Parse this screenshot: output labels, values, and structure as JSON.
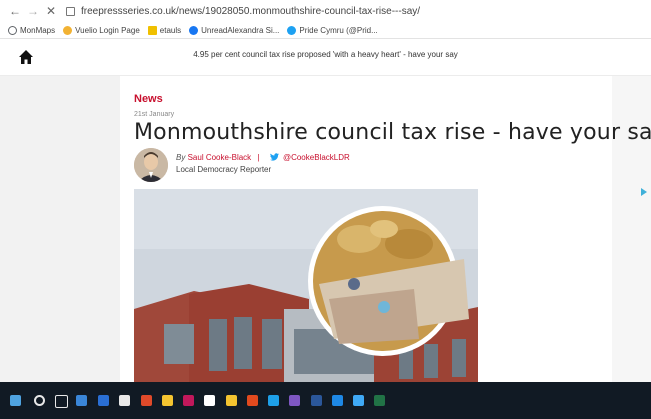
{
  "browser": {
    "url": "freepressseries.co.uk/news/19028050.monmouthshire-council-tax-rise---say/",
    "bookmarks": [
      {
        "label": "MonMaps",
        "color": "#5f6368"
      },
      {
        "label": "Vuelio Login Page",
        "color": "#f2b233"
      },
      {
        "label": "etauls",
        "color": "#f0c000"
      },
      {
        "label": "UnreadAlexandra Si...",
        "color": "#1877f2"
      },
      {
        "label": "Pride Cymru (@Prid...",
        "color": "#1da1f2"
      }
    ]
  },
  "site": {
    "header_title": "4.95 per cent council tax rise proposed 'with a heavy heart' - have your say"
  },
  "article": {
    "section": "News",
    "date": "21st January",
    "headline": "Monmouthshire council tax rise - have your say",
    "by": "By",
    "author": "Saul Cooke-Black",
    "separator": "|",
    "twitter_handle": "@CookeBlackLDR",
    "role": "Local Democracy Reporter"
  },
  "colors": {
    "accent": "#c8102e",
    "twitter": "#1da1f2",
    "taskbar": "#111a24"
  }
}
